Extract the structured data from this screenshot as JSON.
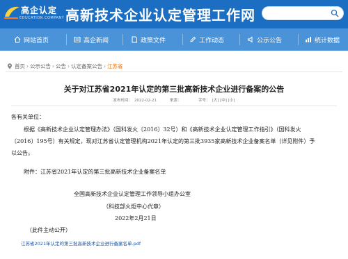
{
  "header": {
    "logo_text": "高企认定",
    "logo_sub": "EDUCATION COMPANY",
    "site_title": "高新技术企业认定管理工作网",
    "search_placeholder": ""
  },
  "nav": {
    "items": [
      {
        "label": "网站首页",
        "icon": "home-icon"
      },
      {
        "label": "高企新闻",
        "icon": "news-icon"
      },
      {
        "label": "政策文件",
        "icon": "document-icon"
      },
      {
        "label": "工作动态",
        "icon": "pen-icon"
      },
      {
        "label": "公示公告",
        "icon": "notice-icon"
      },
      {
        "label": "统计数据",
        "icon": "stats-icon"
      }
    ]
  },
  "breadcrumb": {
    "items": [
      "首页",
      "公示公告",
      "公告",
      "认定备案公告"
    ],
    "current": "江苏省"
  },
  "article": {
    "title": "关于对江苏省2021年认定的第三批高新技术企业进行备案的公告",
    "meta_date_label": "发布时间：",
    "meta_date": "2022-02-21",
    "meta_source": "来源：",
    "meta_size_label": "字号：",
    "meta_size_options": "[大] [中] [小]",
    "salutation": "各有关单位：",
    "para1_line1": "根据《高新技术企业认定管理办法》（国科发火〔2016〕32号）和《高新技术企业认定管理工作指引》（国科发火",
    "para1_line2": "〔2016〕195号）有关规定，现对江苏省认定管理机构2021年认定的第三批3935家高新技术企业备案名单（详见附件）予",
    "para1_line3": "以公告。",
    "attachment_label": "附件：江苏省2021年认定的第三批高新技术企业备案名单",
    "signature_org": "全国高新技术企业认定管理工作领导小组办公室",
    "signature_sub": "（科技部火炬中心代章）",
    "signature_date": "2022年2月21日",
    "public_note": "（此件主动公开）",
    "file_link": "江苏省2021年认定的第三批高新技术企业进行备案名单.pdf"
  }
}
